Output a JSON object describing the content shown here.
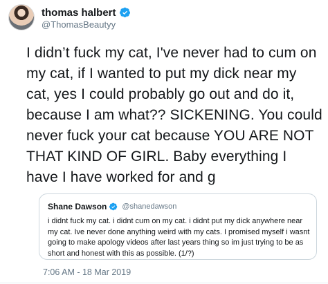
{
  "author": {
    "display_name": "thomas halbert",
    "handle": "@ThomasBeautyy",
    "verified_icon": "verified-badge-icon",
    "badge_color": "#1da1f2"
  },
  "tweet": {
    "text": "I didn’t fuck my cat, I've never had to cum on my cat, if I wanted to put my dick near my cat, yes I could probably go out and do it, because I am what?? SICKENING. You could never fuck your cat because YOU ARE NOT THAT KIND OF GIRL. Baby everything I have I have worked for and g",
    "timestamp": "7:06 AM - 18 Mar 2019"
  },
  "quoted_tweet": {
    "display_name": "Shane Dawson",
    "handle": "@shanedawson",
    "text": "i didnt fuck my cat. i didnt cum on my cat. i didnt put my dick anywhere near my cat. Ive never done anything weird with my cats. I promised myself i wasnt going to make apology videos after last years thing so im just trying to be as short and honest with this as possible. (1/?)"
  }
}
